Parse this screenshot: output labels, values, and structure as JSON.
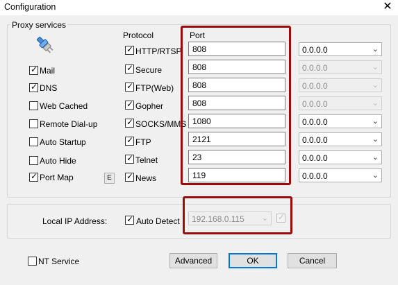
{
  "window": {
    "title": "Configuration",
    "close_glyph": "✕"
  },
  "proxy_group": {
    "title": "Proxy services"
  },
  "protocol_header": "Protocol",
  "port_header": "Port",
  "services_left": [
    {
      "label": "Mail",
      "checked": true
    },
    {
      "label": "DNS",
      "checked": true
    },
    {
      "label": "Web Cached",
      "checked": false
    },
    {
      "label": "Remote Dial-up",
      "checked": false
    },
    {
      "label": "Auto Startup",
      "checked": false
    },
    {
      "label": "Auto Hide",
      "checked": false
    },
    {
      "label": "Port Map",
      "checked": true
    }
  ],
  "port_map_edit_label": "E",
  "protocols": [
    {
      "label": "HTTP/RTSP",
      "checked": true,
      "port": "808",
      "ip": "0.0.0.0",
      "ip_enabled": true
    },
    {
      "label": "Secure",
      "checked": true,
      "port": "808",
      "ip": "0.0.0.0",
      "ip_enabled": false
    },
    {
      "label": "FTP(Web)",
      "checked": true,
      "port": "808",
      "ip": "0.0.0.0",
      "ip_enabled": false
    },
    {
      "label": "Gopher",
      "checked": true,
      "port": "808",
      "ip": "0.0.0.0",
      "ip_enabled": false
    },
    {
      "label": "SOCKS/MMS",
      "checked": true,
      "port": "1080",
      "ip": "0.0.0.0",
      "ip_enabled": true
    },
    {
      "label": "FTP",
      "checked": true,
      "port": "2121",
      "ip": "0.0.0.0",
      "ip_enabled": true
    },
    {
      "label": "Telnet",
      "checked": true,
      "port": "23",
      "ip": "0.0.0.0",
      "ip_enabled": true
    },
    {
      "label": "News",
      "checked": true,
      "port": "119",
      "ip": "0.0.0.0",
      "ip_enabled": true
    }
  ],
  "local_ip": {
    "label": "Local IP Address:",
    "auto_detect_label": "Auto Detect",
    "auto_detect_checked": true,
    "address": "192.168.0.115",
    "address_enabled": false,
    "extra_checked": true
  },
  "nt_service": {
    "label": "NT Service",
    "checked": false
  },
  "buttons": {
    "advanced": "Advanced",
    "ok": "OK",
    "cancel": "Cancel"
  },
  "icons": {
    "dropdown": "chevron-down-icon",
    "app": "network-plug-icon"
  },
  "colors": {
    "highlight_border": "#9b0b0b",
    "default_button_border": "#0078d7"
  }
}
